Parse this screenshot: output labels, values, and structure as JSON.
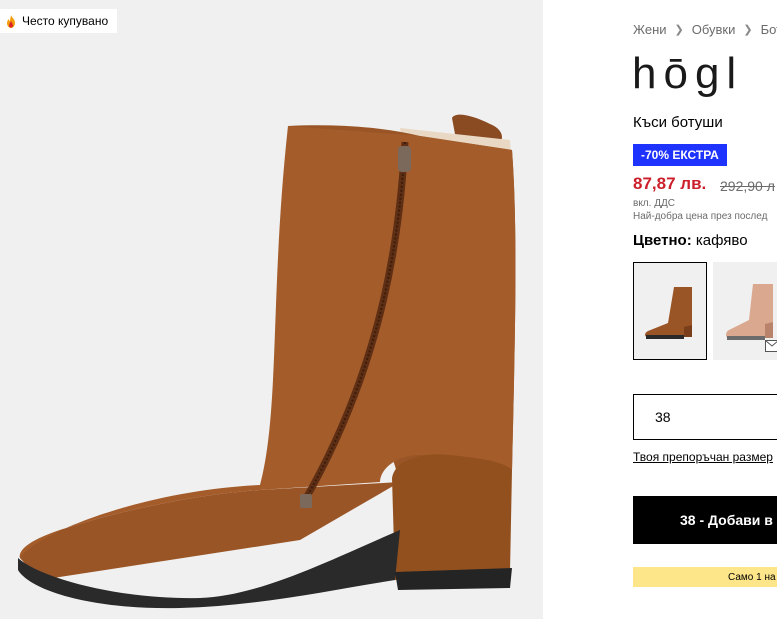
{
  "gallery": {
    "badge_icon": "flame-icon",
    "badge_label": "Често купувано"
  },
  "breadcrumb": {
    "items": [
      "Жени",
      "Обувки",
      "Бот"
    ],
    "separator_icon": "chevron-right-icon"
  },
  "product": {
    "brand": "hōgl",
    "name": "Къси ботуши",
    "promo_badge": "-70% ЕКСТРА",
    "price_current": "87,87 лв.",
    "price_old": "292,90 л",
    "vat_note": "вкл. ДДС",
    "best_price_note": "Най-добра цена през послед"
  },
  "color": {
    "label": "Цветно:",
    "value": "кафяво",
    "swatches": [
      {
        "name": "brown-boot",
        "selected": true
      },
      {
        "name": "beige-boot",
        "selected": false,
        "icon": "mail-icon"
      }
    ]
  },
  "size": {
    "value": "38",
    "recommended_label": "Твоя препоръчан размер"
  },
  "cart": {
    "add_button_label": "38 - Добави в"
  },
  "stock": {
    "note": "Само 1 на"
  },
  "colors": {
    "promo_bg": "#1f33ff",
    "price_red": "#cc1f2b",
    "stock_bg": "#fde68a",
    "boot_brown": "#9a5526"
  }
}
